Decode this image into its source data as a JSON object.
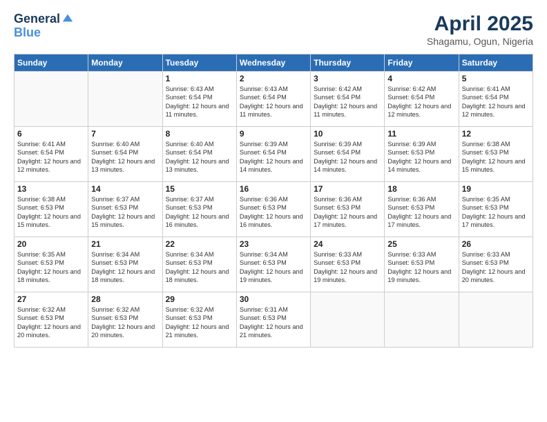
{
  "logo": {
    "line1": "General",
    "line2": "Blue"
  },
  "header": {
    "month": "April 2025",
    "location": "Shagamu, Ogun, Nigeria"
  },
  "weekdays": [
    "Sunday",
    "Monday",
    "Tuesday",
    "Wednesday",
    "Thursday",
    "Friday",
    "Saturday"
  ],
  "weeks": [
    [
      {
        "day": "",
        "info": ""
      },
      {
        "day": "",
        "info": ""
      },
      {
        "day": "1",
        "info": "Sunrise: 6:43 AM\nSunset: 6:54 PM\nDaylight: 12 hours and 11 minutes."
      },
      {
        "day": "2",
        "info": "Sunrise: 6:43 AM\nSunset: 6:54 PM\nDaylight: 12 hours and 11 minutes."
      },
      {
        "day": "3",
        "info": "Sunrise: 6:42 AM\nSunset: 6:54 PM\nDaylight: 12 hours and 11 minutes."
      },
      {
        "day": "4",
        "info": "Sunrise: 6:42 AM\nSunset: 6:54 PM\nDaylight: 12 hours and 12 minutes."
      },
      {
        "day": "5",
        "info": "Sunrise: 6:41 AM\nSunset: 6:54 PM\nDaylight: 12 hours and 12 minutes."
      }
    ],
    [
      {
        "day": "6",
        "info": "Sunrise: 6:41 AM\nSunset: 6:54 PM\nDaylight: 12 hours and 12 minutes."
      },
      {
        "day": "7",
        "info": "Sunrise: 6:40 AM\nSunset: 6:54 PM\nDaylight: 12 hours and 13 minutes."
      },
      {
        "day": "8",
        "info": "Sunrise: 6:40 AM\nSunset: 6:54 PM\nDaylight: 12 hours and 13 minutes."
      },
      {
        "day": "9",
        "info": "Sunrise: 6:39 AM\nSunset: 6:54 PM\nDaylight: 12 hours and 14 minutes."
      },
      {
        "day": "10",
        "info": "Sunrise: 6:39 AM\nSunset: 6:54 PM\nDaylight: 12 hours and 14 minutes."
      },
      {
        "day": "11",
        "info": "Sunrise: 6:39 AM\nSunset: 6:53 PM\nDaylight: 12 hours and 14 minutes."
      },
      {
        "day": "12",
        "info": "Sunrise: 6:38 AM\nSunset: 6:53 PM\nDaylight: 12 hours and 15 minutes."
      }
    ],
    [
      {
        "day": "13",
        "info": "Sunrise: 6:38 AM\nSunset: 6:53 PM\nDaylight: 12 hours and 15 minutes."
      },
      {
        "day": "14",
        "info": "Sunrise: 6:37 AM\nSunset: 6:53 PM\nDaylight: 12 hours and 15 minutes."
      },
      {
        "day": "15",
        "info": "Sunrise: 6:37 AM\nSunset: 6:53 PM\nDaylight: 12 hours and 16 minutes."
      },
      {
        "day": "16",
        "info": "Sunrise: 6:36 AM\nSunset: 6:53 PM\nDaylight: 12 hours and 16 minutes."
      },
      {
        "day": "17",
        "info": "Sunrise: 6:36 AM\nSunset: 6:53 PM\nDaylight: 12 hours and 17 minutes."
      },
      {
        "day": "18",
        "info": "Sunrise: 6:36 AM\nSunset: 6:53 PM\nDaylight: 12 hours and 17 minutes."
      },
      {
        "day": "19",
        "info": "Sunrise: 6:35 AM\nSunset: 6:53 PM\nDaylight: 12 hours and 17 minutes."
      }
    ],
    [
      {
        "day": "20",
        "info": "Sunrise: 6:35 AM\nSunset: 6:53 PM\nDaylight: 12 hours and 18 minutes."
      },
      {
        "day": "21",
        "info": "Sunrise: 6:34 AM\nSunset: 6:53 PM\nDaylight: 12 hours and 18 minutes."
      },
      {
        "day": "22",
        "info": "Sunrise: 6:34 AM\nSunset: 6:53 PM\nDaylight: 12 hours and 18 minutes."
      },
      {
        "day": "23",
        "info": "Sunrise: 6:34 AM\nSunset: 6:53 PM\nDaylight: 12 hours and 19 minutes."
      },
      {
        "day": "24",
        "info": "Sunrise: 6:33 AM\nSunset: 6:53 PM\nDaylight: 12 hours and 19 minutes."
      },
      {
        "day": "25",
        "info": "Sunrise: 6:33 AM\nSunset: 6:53 PM\nDaylight: 12 hours and 19 minutes."
      },
      {
        "day": "26",
        "info": "Sunrise: 6:33 AM\nSunset: 6:53 PM\nDaylight: 12 hours and 20 minutes."
      }
    ],
    [
      {
        "day": "27",
        "info": "Sunrise: 6:32 AM\nSunset: 6:53 PM\nDaylight: 12 hours and 20 minutes."
      },
      {
        "day": "28",
        "info": "Sunrise: 6:32 AM\nSunset: 6:53 PM\nDaylight: 12 hours and 20 minutes."
      },
      {
        "day": "29",
        "info": "Sunrise: 6:32 AM\nSunset: 6:53 PM\nDaylight: 12 hours and 21 minutes."
      },
      {
        "day": "30",
        "info": "Sunrise: 6:31 AM\nSunset: 6:53 PM\nDaylight: 12 hours and 21 minutes."
      },
      {
        "day": "",
        "info": ""
      },
      {
        "day": "",
        "info": ""
      },
      {
        "day": "",
        "info": ""
      }
    ]
  ]
}
